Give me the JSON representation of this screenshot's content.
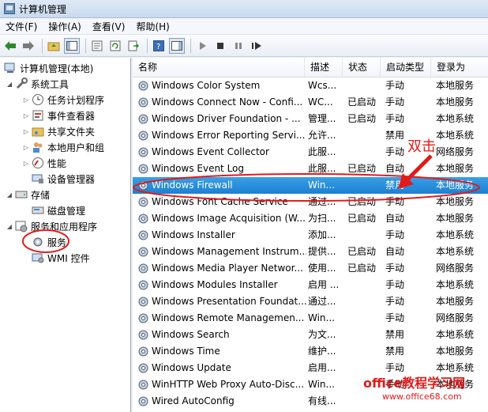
{
  "window": {
    "title": "计算机管理"
  },
  "menu": [
    "文件(F)",
    "操作(A)",
    "查看(V)",
    "帮助(H)"
  ],
  "tree": {
    "root": "计算机管理(本地)",
    "system_tools": "系统工具",
    "task_scheduler": "任务计划程序",
    "event_viewer": "事件查看器",
    "shared_folders": "共享文件夹",
    "local_users": "本地用户和组",
    "performance": "性能",
    "device_manager": "设备管理器",
    "storage": "存储",
    "disk_management": "磁盘管理",
    "services_apps": "服务和应用程序",
    "services": "服务",
    "wmi": "WMI 控件"
  },
  "columns": [
    "名称",
    "描述",
    "状态",
    "启动类型",
    "登录为"
  ],
  "services": [
    {
      "name": "Windows Color System",
      "desc": "Wcs...",
      "status": "",
      "startup": "手动",
      "logon": "本地服务"
    },
    {
      "name": "Windows Connect Now - Confi...",
      "desc": "WC...",
      "status": "已启动",
      "startup": "手动",
      "logon": "本地服务"
    },
    {
      "name": "Windows Driver Foundation - ...",
      "desc": "管理...",
      "status": "已启动",
      "startup": "手动",
      "logon": "本地系统"
    },
    {
      "name": "Windows Error Reporting Servi...",
      "desc": "允许...",
      "status": "",
      "startup": "禁用",
      "logon": "本地系统"
    },
    {
      "name": "Windows Event Collector",
      "desc": "此服...",
      "status": "",
      "startup": "手动",
      "logon": "网络服务"
    },
    {
      "name": "Windows Event Log",
      "desc": "此服...",
      "status": "已启动",
      "startup": "自动",
      "logon": "本地服务"
    },
    {
      "name": "Windows Firewall",
      "desc": "Win...",
      "status": "",
      "startup": "禁用",
      "logon": "本地服务"
    },
    {
      "name": "Windows Font Cache Service",
      "desc": "通过...",
      "status": "已启动",
      "startup": "手动",
      "logon": "本地服务"
    },
    {
      "name": "Windows Image Acquisition (W...",
      "desc": "为扫...",
      "status": "已启动",
      "startup": "自动",
      "logon": "本地服务"
    },
    {
      "name": "Windows Installer",
      "desc": "添加...",
      "status": "",
      "startup": "手动",
      "logon": "本地系统"
    },
    {
      "name": "Windows Management Instrum...",
      "desc": "提供...",
      "status": "已启动",
      "startup": "自动",
      "logon": "本地系统"
    },
    {
      "name": "Windows Media Player Networ...",
      "desc": "使用...",
      "status": "已启动",
      "startup": "手动",
      "logon": "网络服务"
    },
    {
      "name": "Windows Modules Installer",
      "desc": "启用 ...",
      "status": "",
      "startup": "手动",
      "logon": "本地系统"
    },
    {
      "name": "Windows Presentation Foundat...",
      "desc": "通过...",
      "status": "",
      "startup": "手动",
      "logon": "本地服务"
    },
    {
      "name": "Windows Remote Managemen...",
      "desc": "Win...",
      "status": "",
      "startup": "手动",
      "logon": "网络服务"
    },
    {
      "name": "Windows Search",
      "desc": "为文...",
      "status": "",
      "startup": "禁用",
      "logon": "本地系统"
    },
    {
      "name": "Windows Time",
      "desc": "维护...",
      "status": "",
      "startup": "禁用",
      "logon": "本地服务"
    },
    {
      "name": "Windows Update",
      "desc": "启用...",
      "status": "",
      "startup": "手动",
      "logon": "本地系统"
    },
    {
      "name": "WinHTTP Web Proxy Auto-Disc...",
      "desc": "Win...",
      "status": "",
      "startup": "手动",
      "logon": "本地服务"
    },
    {
      "name": "Wired AutoConfig",
      "desc": "有线...",
      "status": "",
      "startup": "",
      "logon": ""
    }
  ],
  "selected_service": "Windows Firewall",
  "annotation": {
    "label": "双击"
  },
  "watermark": {
    "line1": "office教程学习网",
    "line2": "www.office68.com"
  },
  "colors": {
    "selection": "#1d7fd0",
    "annotation": "#e11b1b"
  }
}
